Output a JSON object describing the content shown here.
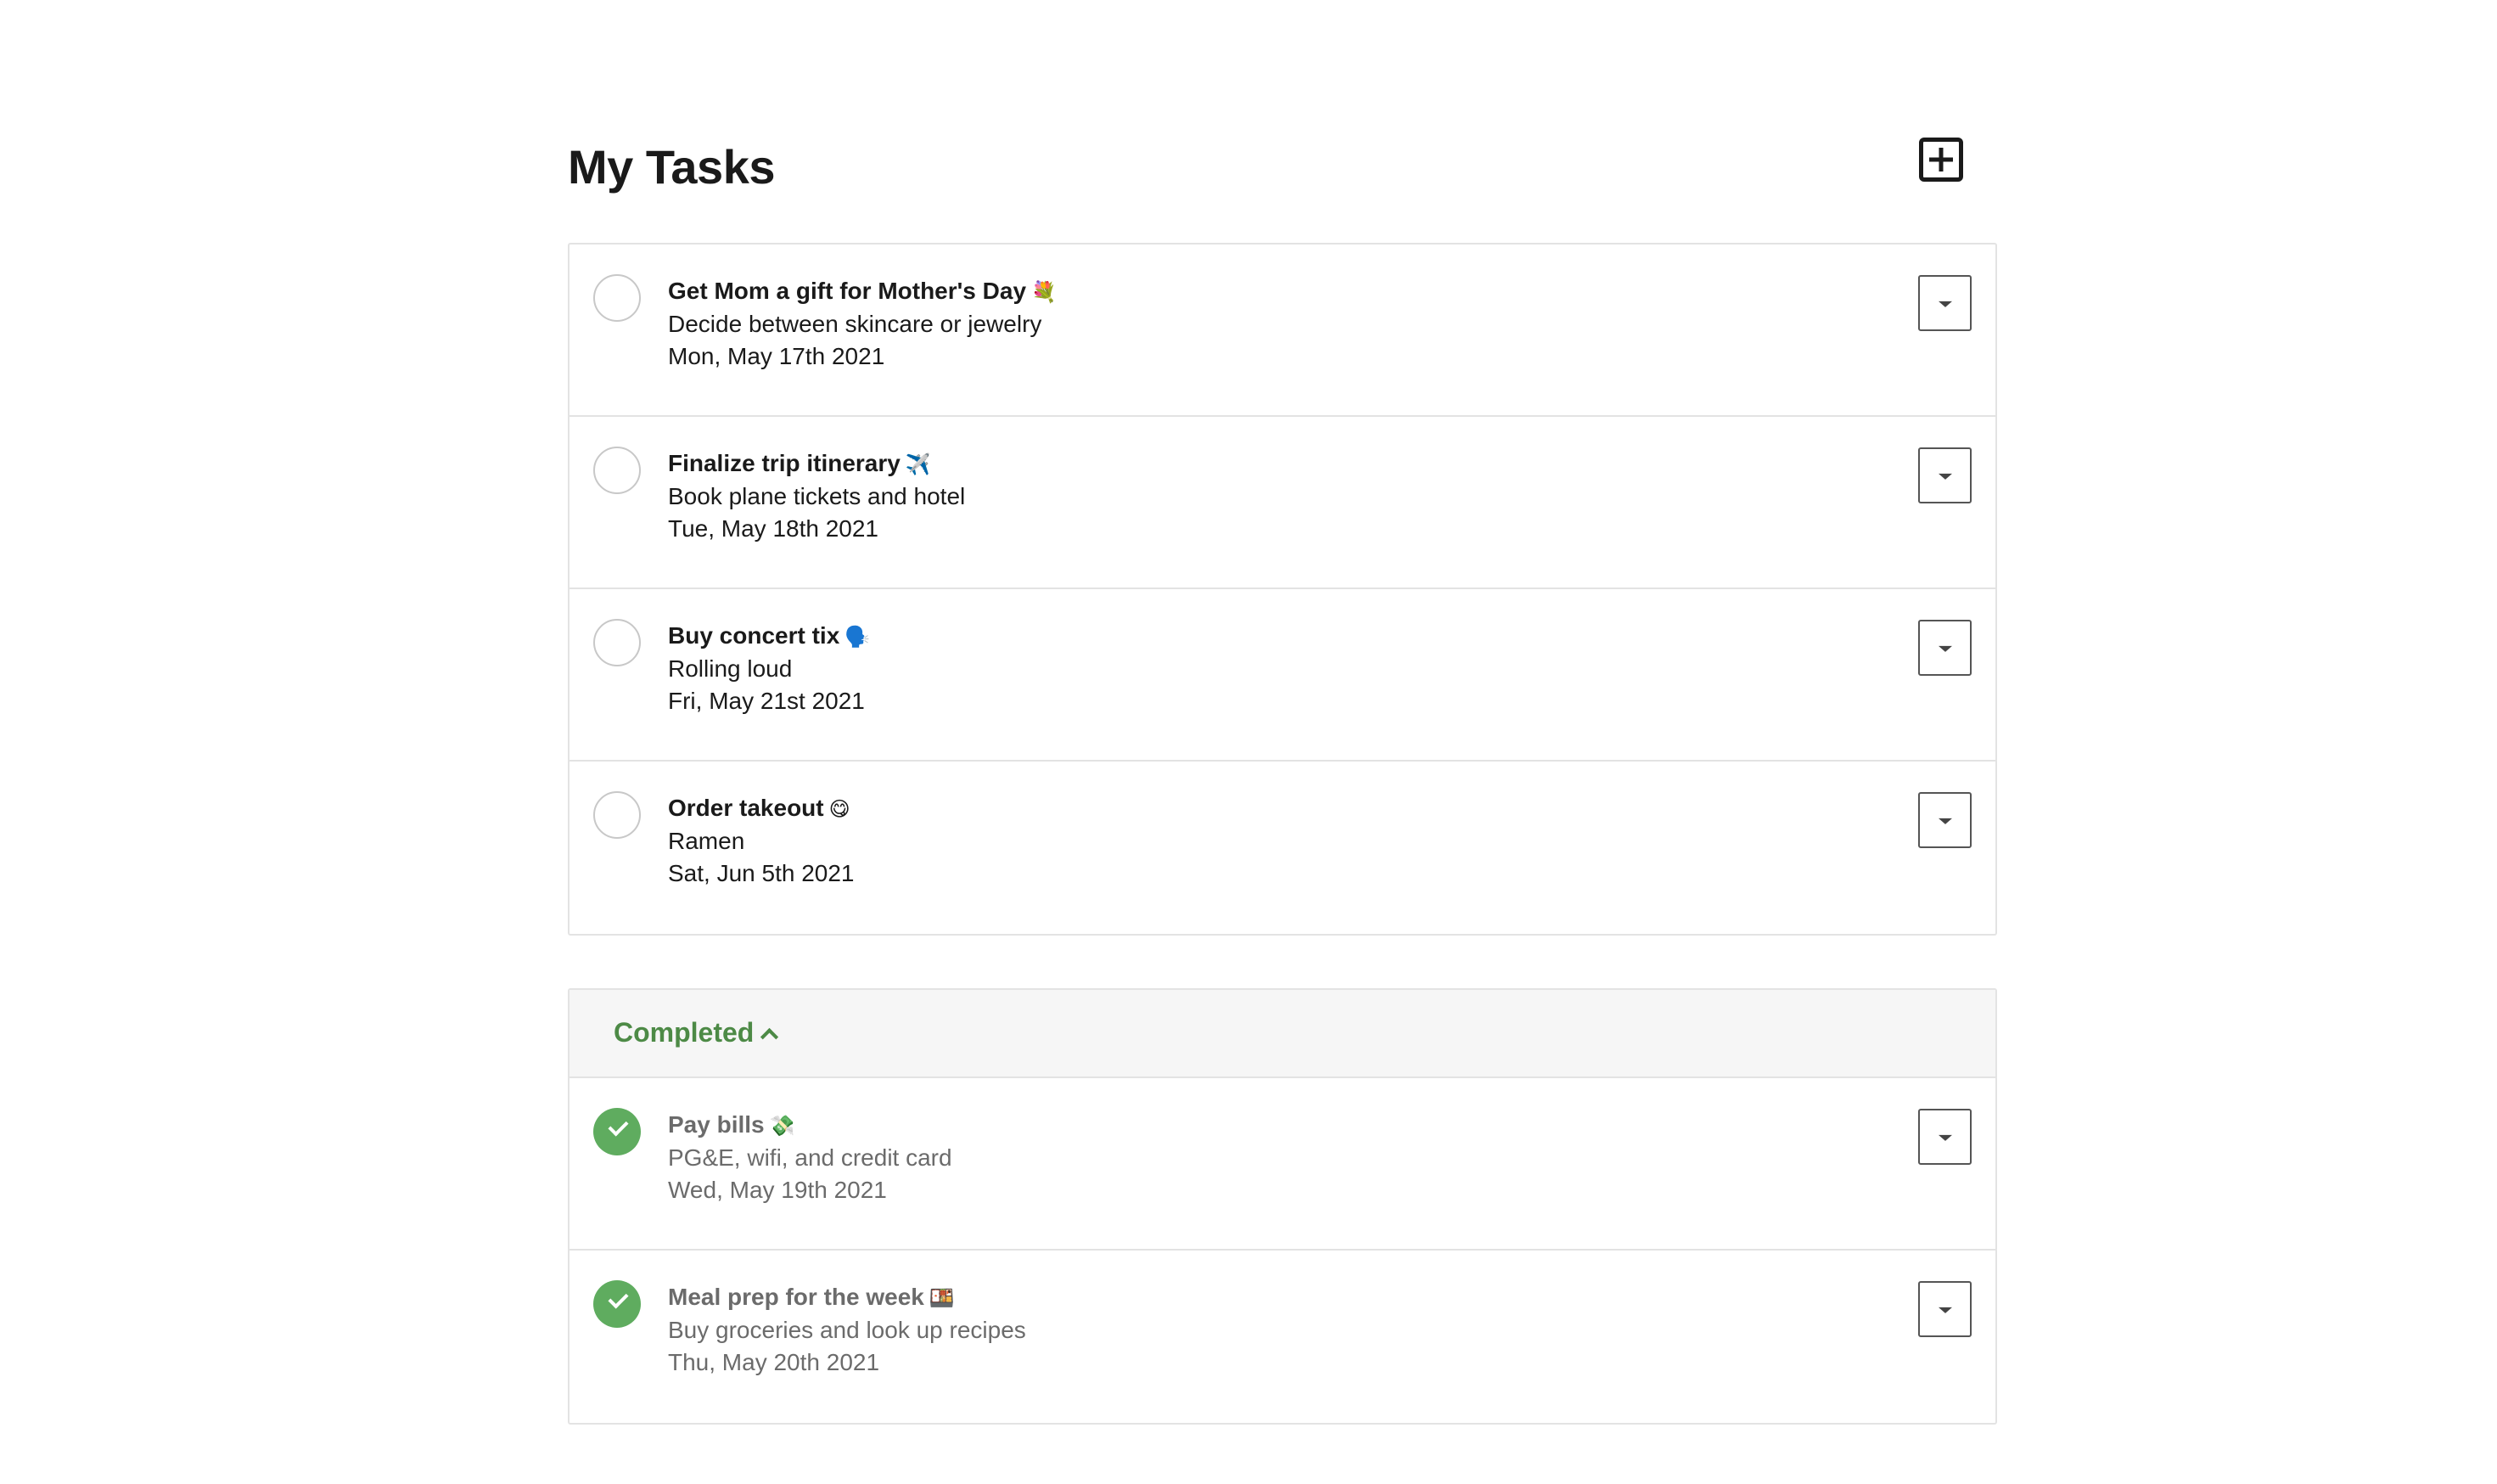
{
  "header": {
    "title": "My Tasks",
    "add_label": "Add task"
  },
  "tasks": [
    {
      "title": "Get Mom a gift for Mother's Day",
      "emoji": "💐",
      "description": "Decide between skincare or jewelry",
      "date": "Mon, May 17th 2021"
    },
    {
      "title": "Finalize trip itinerary",
      "emoji": "✈️",
      "description": "Book plane tickets and hotel",
      "date": "Tue, May 18th 2021"
    },
    {
      "title": "Buy concert tix",
      "emoji": "🗣️",
      "description": "Rolling loud",
      "date": "Fri, May 21st 2021"
    },
    {
      "title": "Order takeout",
      "emoji": "😋",
      "description": "Ramen",
      "date": "Sat, Jun 5th 2021"
    }
  ],
  "completed": {
    "label": "Completed",
    "items": [
      {
        "title": "Pay bills",
        "emoji": "💸",
        "description": "PG&E, wifi, and credit card",
        "date": "Wed, May 19th 2021"
      },
      {
        "title": "Meal prep for the week",
        "emoji": "🍱",
        "description": "Buy groceries and look up recipes",
        "date": "Thu, May 20th 2021"
      }
    ]
  },
  "colors": {
    "accent_green": "#4d8a46",
    "check_green": "#5fac5f",
    "border": "#e3e3e3",
    "completed_text": "#6b6b6b"
  },
  "icons": {
    "add": "plus-square-icon",
    "menu": "caret-down-icon",
    "collapse": "chevron-up-icon",
    "check": "checkmark-icon"
  }
}
